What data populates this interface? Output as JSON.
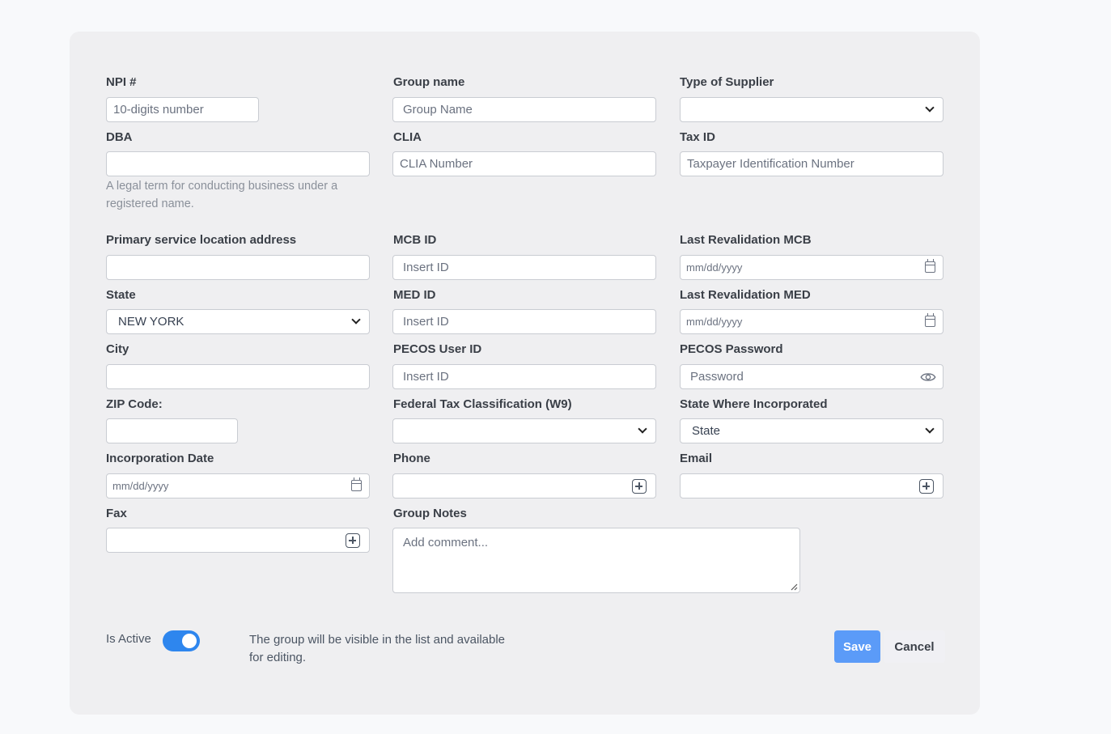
{
  "form": {
    "npi": {
      "label": "NPI #",
      "placeholder": "10-digits number"
    },
    "group_name": {
      "label": "Group name",
      "placeholder": "Group Name"
    },
    "type_of_supplier": {
      "label": "Type of Supplier",
      "value": ""
    },
    "dba": {
      "label": "DBA",
      "value": "",
      "help": "A legal term for conducting business under a registered name."
    },
    "clia": {
      "label": "CLIA",
      "placeholder": "CLIA Number"
    },
    "tax_id": {
      "label": "Tax ID",
      "placeholder": "Taxpayer Identification Number"
    },
    "primary_address": {
      "label": "Primary service location address",
      "value": ""
    },
    "mcb_id": {
      "label": "MCB ID",
      "placeholder": "Insert ID"
    },
    "last_revalidation_mcb": {
      "label": "Last Revalidation MCB",
      "placeholder": "mm/dd/yyyy"
    },
    "state": {
      "label": "State",
      "value": "NEW YORK"
    },
    "med_id": {
      "label": "MED ID",
      "placeholder": "Insert ID"
    },
    "last_revalidation_med": {
      "label": "Last Revalidation MED",
      "placeholder": "mm/dd/yyyy"
    },
    "city": {
      "label": "City",
      "value": ""
    },
    "pecos_user_id": {
      "label": "PECOS User ID",
      "placeholder": "Insert ID"
    },
    "pecos_password": {
      "label": "PECOS Password",
      "placeholder": "Password"
    },
    "zip": {
      "label": "ZIP Code:",
      "value": ""
    },
    "federal_tax_classification": {
      "label": "Federal Tax Classification (W9)",
      "value": ""
    },
    "state_incorporated": {
      "label": "State Where Incorporated",
      "value": "State"
    },
    "incorporation_date": {
      "label": "Incorporation Date",
      "placeholder": "mm/dd/yyyy"
    },
    "phone": {
      "label": "Phone",
      "value": ""
    },
    "email": {
      "label": "Email",
      "value": ""
    },
    "fax": {
      "label": "Fax",
      "value": ""
    },
    "group_notes": {
      "label": "Group Notes",
      "placeholder": "Add comment..."
    }
  },
  "footer": {
    "is_active_label": "Is Active",
    "is_active": true,
    "active_help": "The group will be visible in the list and available for editing.",
    "save_label": "Save",
    "cancel_label": "Cancel"
  },
  "colors": {
    "accent": "#2e86ee",
    "save_button": "#5b9bf8",
    "card_bg": "#efeff1"
  }
}
